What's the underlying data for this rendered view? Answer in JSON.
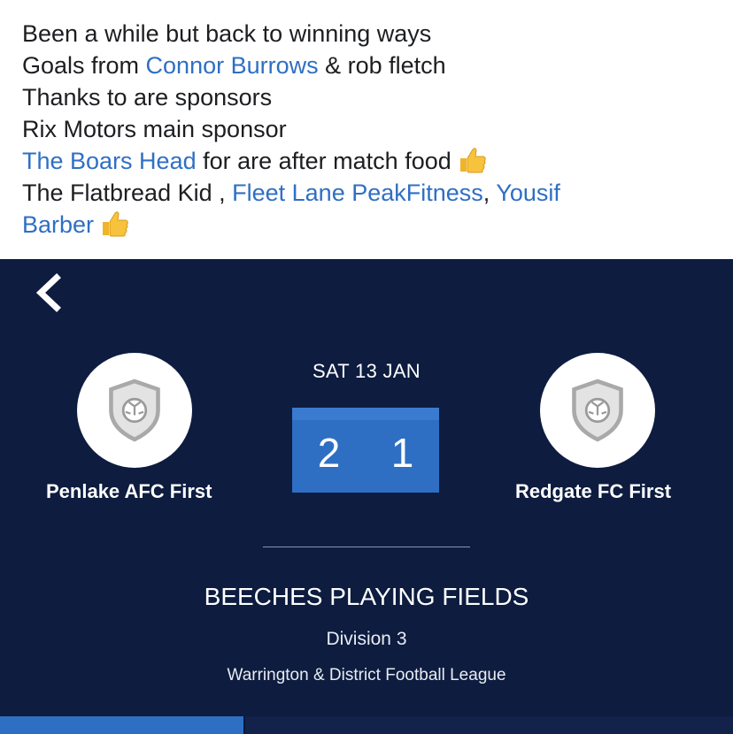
{
  "post": {
    "line1": "Been a while but back to winning ways",
    "line2_prefix": "Goals from ",
    "line2_link": "Connor Burrows",
    "line2_suffix": " & rob fletch",
    "line3": "Thanks to are sponsors",
    "line4": "Rix Motors main sponsor",
    "line5_link": "The Boars Head",
    "line5_suffix": " for are after match food",
    "line6_prefix": "The Flatbread Kid , ",
    "line6_link1": "Fleet Lane PeakFitness",
    "line6_sep": ", ",
    "line6_link2a": "Yousif",
    "line7_link2b": "Barber",
    "emoji": "thumbs-up-emoji"
  },
  "match": {
    "date": "SAT 13 JAN",
    "home_team": "Penlake AFC First",
    "away_team": "Redgate FC First",
    "home_score": "2",
    "away_score": "1",
    "venue": "BEECHES PLAYING FIELDS",
    "division": "Division 3",
    "league": "Warrington & District Football League"
  },
  "colors": {
    "card_bg": "#0d1c3f",
    "accent": "#2e6fc4",
    "link": "#2f6fc4"
  },
  "icons": {
    "back": "chevron-left-icon",
    "badge": "football-shield-icon"
  }
}
